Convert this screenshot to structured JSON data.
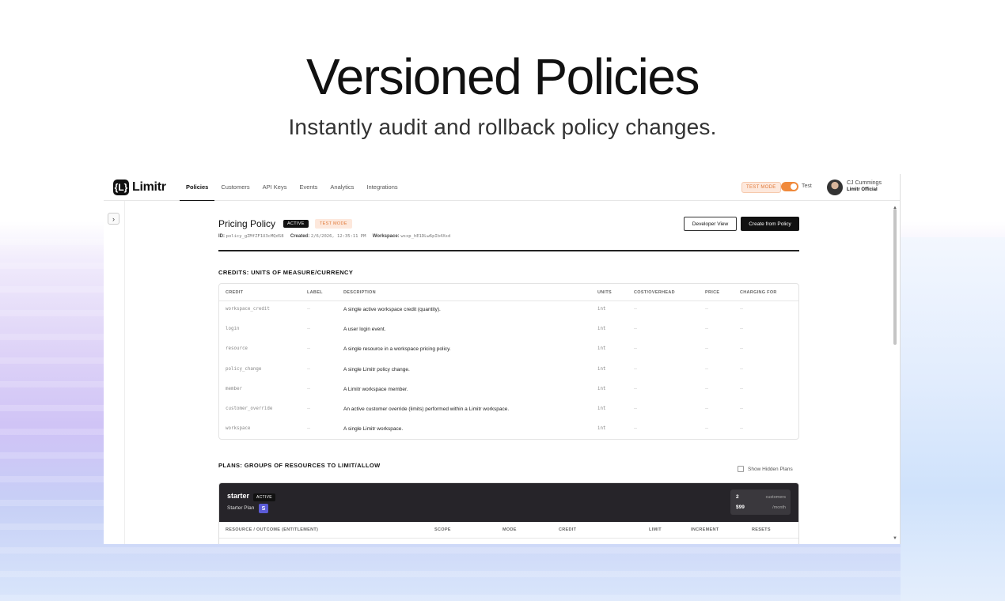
{
  "hero": {
    "title": "Versioned Policies",
    "subtitle": "Instantly audit and rollback policy changes."
  },
  "app": {
    "logo_mark": "{L}",
    "logo_text": "Limitr",
    "nav": [
      "Policies",
      "Customers",
      "API Keys",
      "Events",
      "Analytics",
      "Integrations"
    ],
    "active_nav": "Policies",
    "test_mode_badge": "TEST MODE",
    "toggle_label": "Test",
    "toggle_on": true,
    "user": {
      "name": "CJ Cummings",
      "org": "Limitr Official"
    }
  },
  "policy": {
    "title": "Pricing Policy",
    "status_badge": "ACTIVE",
    "mode_badge": "TEST MODE",
    "id_label": "ID:",
    "id_value": "policy_gZMfZF1U3cMQdS8",
    "created_label": "Created:",
    "created_value": "2/6/2026, 12:35:11 PM",
    "workspace_label": "Workspace:",
    "workspace_value": "wsxp_hE1DLw6pIb4Xsd",
    "developer_view_label": "Developer View",
    "create_from_policy_label": "Create from Policy"
  },
  "credits": {
    "section_title": "CREDITS: UNITS OF MEASURE/CURRENCY",
    "columns": [
      "CREDIT",
      "LABEL",
      "DESCRIPTION",
      "UNITS",
      "COST/OVERHEAD",
      "PRICE",
      "CHARGING FOR"
    ],
    "rows": [
      {
        "credit": "workspace_credit",
        "label": "--",
        "description": "A single active workspace credit (quantity).",
        "units": "int",
        "cost": "--",
        "price": "--",
        "charging": "--"
      },
      {
        "credit": "login",
        "label": "--",
        "description": "A user login event.",
        "units": "int",
        "cost": "--",
        "price": "--",
        "charging": "--"
      },
      {
        "credit": "resource",
        "label": "--",
        "description": "A single resource in a workspace pricing policy.",
        "units": "int",
        "cost": "--",
        "price": "--",
        "charging": "--"
      },
      {
        "credit": "policy_change",
        "label": "--",
        "description": "A single Limitr policy change.",
        "units": "int",
        "cost": "--",
        "price": "--",
        "charging": "--"
      },
      {
        "credit": "member",
        "label": "--",
        "description": "A Limitr workspace member.",
        "units": "int",
        "cost": "--",
        "price": "--",
        "charging": "--"
      },
      {
        "credit": "customer_override",
        "label": "--",
        "description": "An active customer override (limits) performed within a Limitr workspace.",
        "units": "int",
        "cost": "--",
        "price": "--",
        "charging": "--"
      },
      {
        "credit": "workspace",
        "label": "--",
        "description": "A single Limitr workspace.",
        "units": "int",
        "cost": "--",
        "price": "--",
        "charging": "--"
      }
    ]
  },
  "plans": {
    "section_title": "PLANS: GROUPS OF RESOURCES TO LIMIT/ALLOW",
    "show_hidden_label": "Show Hidden Plans",
    "show_hidden_checked": false,
    "card": {
      "name": "starter",
      "status_badge": "ACTIVE",
      "display_name": "Starter Plan",
      "icon_letter": "S",
      "customers_value": "2",
      "customers_label": "customers",
      "price_value": "$99",
      "price_label": "/month"
    },
    "columns": [
      "RESOURCE / OUTCOME (ENTITLEMENT)",
      "SCOPE",
      "MODE",
      "CREDIT",
      "LIMIT",
      "INCREMENT",
      "RESETS"
    ]
  },
  "colors": {
    "accent_orange": "#f08a3c",
    "dark": "#111111",
    "plan_header": "#262429",
    "plan_icon": "#5b5bd6"
  }
}
